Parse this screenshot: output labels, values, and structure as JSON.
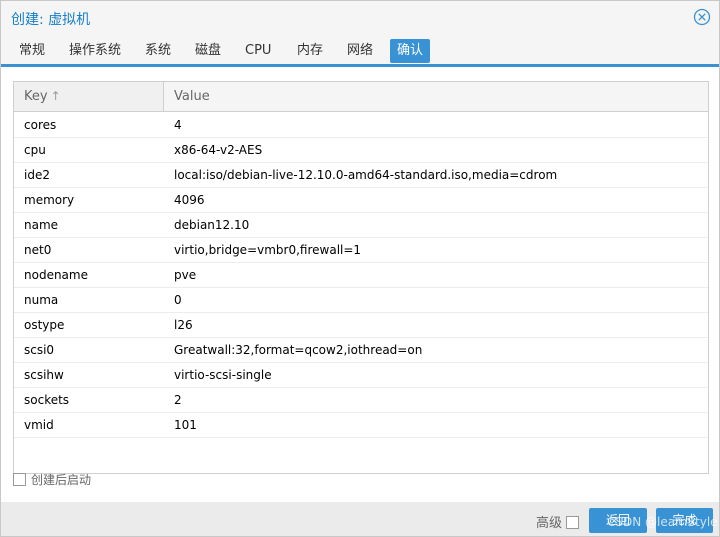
{
  "window": {
    "title": "创建: 虚拟机"
  },
  "tabs": [
    {
      "label": "常规"
    },
    {
      "label": "操作系统"
    },
    {
      "label": "系统"
    },
    {
      "label": "磁盘"
    },
    {
      "label": "CPU"
    },
    {
      "label": "内存"
    },
    {
      "label": "网络"
    },
    {
      "label": "确认",
      "active": true
    }
  ],
  "grid": {
    "columns": {
      "key": "Key",
      "value": "Value"
    },
    "sort": {
      "column": "key",
      "direction": "asc",
      "icon": "sort-up-icon"
    },
    "rows": [
      {
        "key": "cores",
        "value": "4"
      },
      {
        "key": "cpu",
        "value": "x86-64-v2-AES"
      },
      {
        "key": "ide2",
        "value": "local:iso/debian-live-12.10.0-amd64-standard.iso,media=cdrom"
      },
      {
        "key": "memory",
        "value": "4096"
      },
      {
        "key": "name",
        "value": "debian12.10"
      },
      {
        "key": "net0",
        "value": "virtio,bridge=vmbr0,firewall=1"
      },
      {
        "key": "nodename",
        "value": "pve"
      },
      {
        "key": "numa",
        "value": "0"
      },
      {
        "key": "ostype",
        "value": "l26"
      },
      {
        "key": "scsi0",
        "value": "Greatwall:32,format=qcow2,iothread=on"
      },
      {
        "key": "scsihw",
        "value": "virtio-scsi-single"
      },
      {
        "key": "sockets",
        "value": "2"
      },
      {
        "key": "vmid",
        "value": "101"
      }
    ]
  },
  "options": {
    "start_after_create": {
      "label": "创建后启动",
      "checked": false
    }
  },
  "footer": {
    "advanced_label": "高级",
    "advanced_checked": false,
    "back_label": "返回",
    "finish_label": "完成"
  },
  "watermark": "CSDN @learnStyle",
  "colors": {
    "accent": "#3892d4",
    "title": "#157fcc",
    "header_bg": "#f5f5f5",
    "footer_bg": "#ebebeb"
  }
}
